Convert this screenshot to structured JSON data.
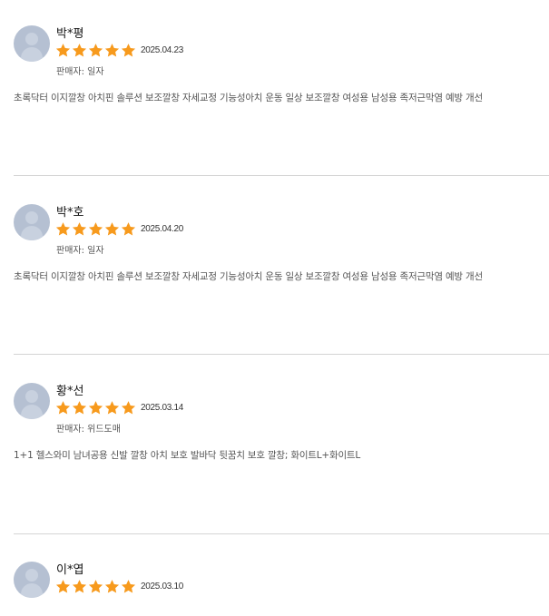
{
  "colors": {
    "star": "#f79a1d",
    "avatar": "#b5c0d2",
    "divider": "#d4d4d4"
  },
  "reviews": [
    {
      "name": "박*평",
      "rating": 5,
      "date": "2025.04.23",
      "seller": "판매자: 일자",
      "option": "초록닥터 이지깔창 아치핀 솔루션 보조깔창 자세교정 기능성아치 운동 일상 보조깔창 여성용 남성용 족저근막염 예방 개선"
    },
    {
      "name": "박*호",
      "rating": 5,
      "date": "2025.04.20",
      "seller": "판매자: 일자",
      "option": "초록닥터 이지깔창 아치핀 솔루션 보조깔창 자세교정 기능성아치 운동 일상 보조깔창 여성용 남성용 족저근막염 예방 개선"
    },
    {
      "name": "황*선",
      "rating": 5,
      "date": "2025.03.14",
      "seller": "판매자: 위드도매",
      "option": "1+1 헬스와미 남녀공용 신발 깔창 아치 보호 발바닥 뒷꿈치 보호 깔창; 화이트L+화이트L"
    },
    {
      "name": "이*엽",
      "rating": 5,
      "date": "2025.03.10",
      "seller": "",
      "option": ""
    }
  ]
}
